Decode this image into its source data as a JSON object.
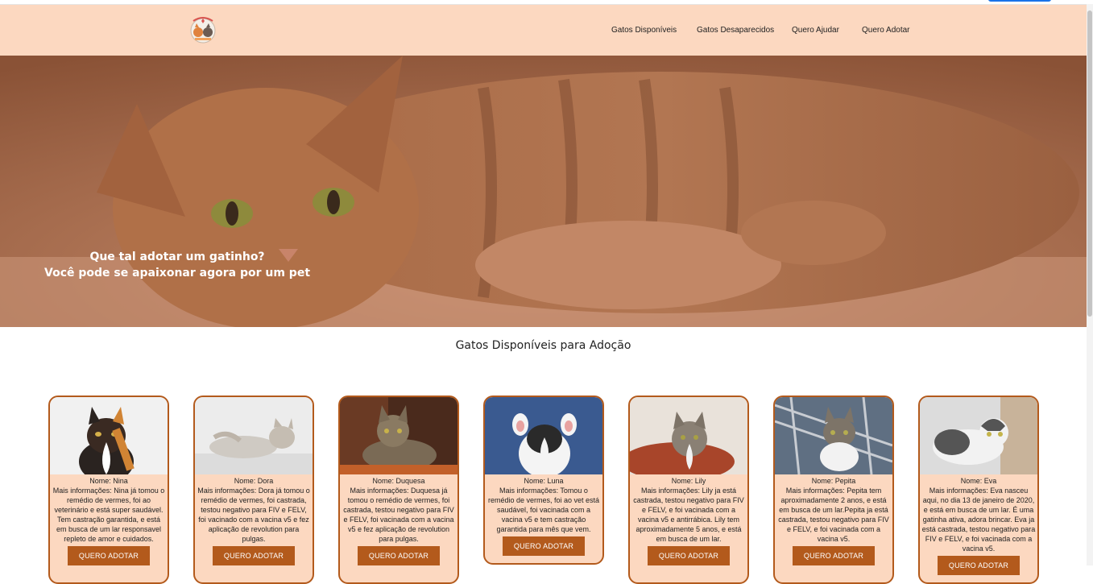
{
  "nav": {
    "logo_icon": "cat-logo-icon",
    "links": [
      "Gatos Disponíveis",
      "Gatos Desaparecidos",
      "Quero Ajudar",
      "Quero Adotar"
    ]
  },
  "hero": {
    "line1": "Que tal adotar um gatinho?",
    "line2": "Você pode se apaixonar agora por um pet"
  },
  "section": {
    "title": "Gatos Disponíveis para Adoção"
  },
  "colors": {
    "nav_bg": "#fcd8c0",
    "accent": "#b35a1c",
    "card_bg": "#fcd8c0"
  },
  "cards": [
    {
      "name": "Nome: Nina",
      "info": "Mais informações: Nina já tomou o remédio de vermes, foi ao veterinário e está super saudável. Tem castração garantida, e está em busca de um lar responsavel repleto de amor e cuidados.",
      "button": "QUERO ADOTAR"
    },
    {
      "name": "Nome: Dora",
      "info": "Mais informações: Dora já tomou o remédio de vermes, foi castrada, testou negativo para FIV e FELV, foi vacinado com a vacina v5 e fez aplicação de revolution para pulgas.",
      "button": "QUERO ADOTAR"
    },
    {
      "name": "Nome: Duquesa",
      "info": "Mais informações: Duquesa já tomou o remédio de vermes, foi castrada, testou negativo para FIV e FELV, foi vacinada com a vacina v5 e fez aplicação de revolution para pulgas.",
      "button": "QUERO ADOTAR"
    },
    {
      "name": "Nome: Luna",
      "info": "Mais informações: Tomou o remédio de vermes, foi ao vet está saudável, foi vacinada com a vacina v5 e tem castração garantida para mês que vem.",
      "button": "QUERO ADOTAR"
    },
    {
      "name": "Nome: Lily",
      "info": "Mais informações: Lily ja está castrada, testou negativo para FIV e FELV, e foi vacinada com a vacina v5 e antirrábica. Lily tem aproximadamente 5 anos, e está em busca de um lar.",
      "button": "QUERO ADOTAR"
    },
    {
      "name": "Nome: Pepita",
      "info": "Mais informações: Pepita tem aproximadamente 2 anos, e está em busca de um lar.Pepita ja está castrada, testou negativo para FIV e FELV, e foi vacinada com a vacina v5.",
      "button": "QUERO ADOTAR"
    },
    {
      "name": "Nome: Eva",
      "info": "Mais informações: Eva nasceu aqui, no dia 13 de janeiro de 2020, e está em busca de um lar. É uma gatinha ativa, adora brincar. Eva ja está castrada, testou negativo para FIV e FELV, e foi vacinada com a vacina v5.",
      "button": "QUERO ADOTAR"
    }
  ]
}
